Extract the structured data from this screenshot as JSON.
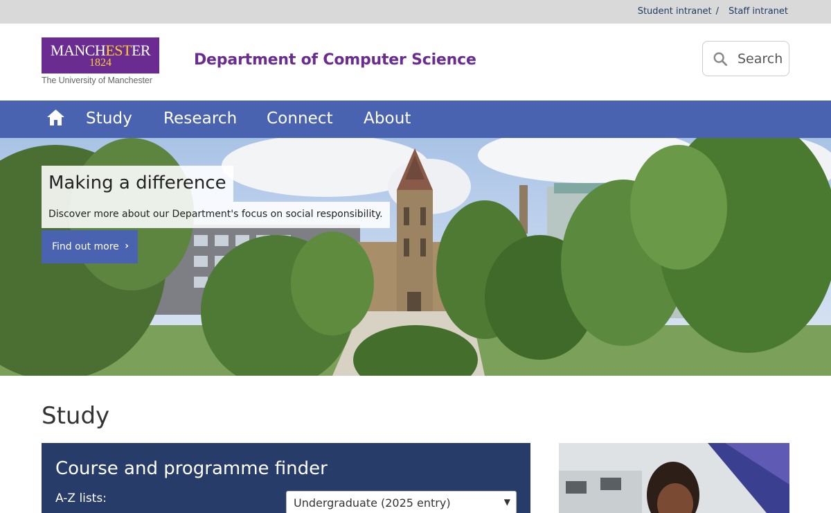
{
  "utility": {
    "student_intranet": "Student intranet",
    "separator": "/",
    "staff_intranet": "Staff intranet"
  },
  "header": {
    "logo": {
      "wordmark_part1": "MANCH",
      "wordmark_gold": "EST",
      "wordmark_part2": "ER",
      "year": "1824",
      "subtitle": "The University of Manchester"
    },
    "department_title": "Department of Computer Science",
    "search_label": "Search"
  },
  "nav": {
    "home_icon": "home-icon",
    "items": [
      {
        "label": "Study"
      },
      {
        "label": "Research"
      },
      {
        "label": "Connect"
      },
      {
        "label": "About"
      }
    ]
  },
  "hero": {
    "title": "Making a difference",
    "text": "Discover more about our Department's focus on social responsibility.",
    "button_label": "Find out more",
    "button_icon": "chevron-right-icon"
  },
  "study": {
    "heading": "Study",
    "finder": {
      "title": "Course and programme finder",
      "az_label": "A-Z lists:",
      "selected_option": "Undergraduate (2025 entry)"
    }
  },
  "colors": {
    "brand_purple": "#6a2c91",
    "nav_blue": "#4a63b0",
    "finder_navy": "#283c6a",
    "gold": "#ffcc33"
  }
}
